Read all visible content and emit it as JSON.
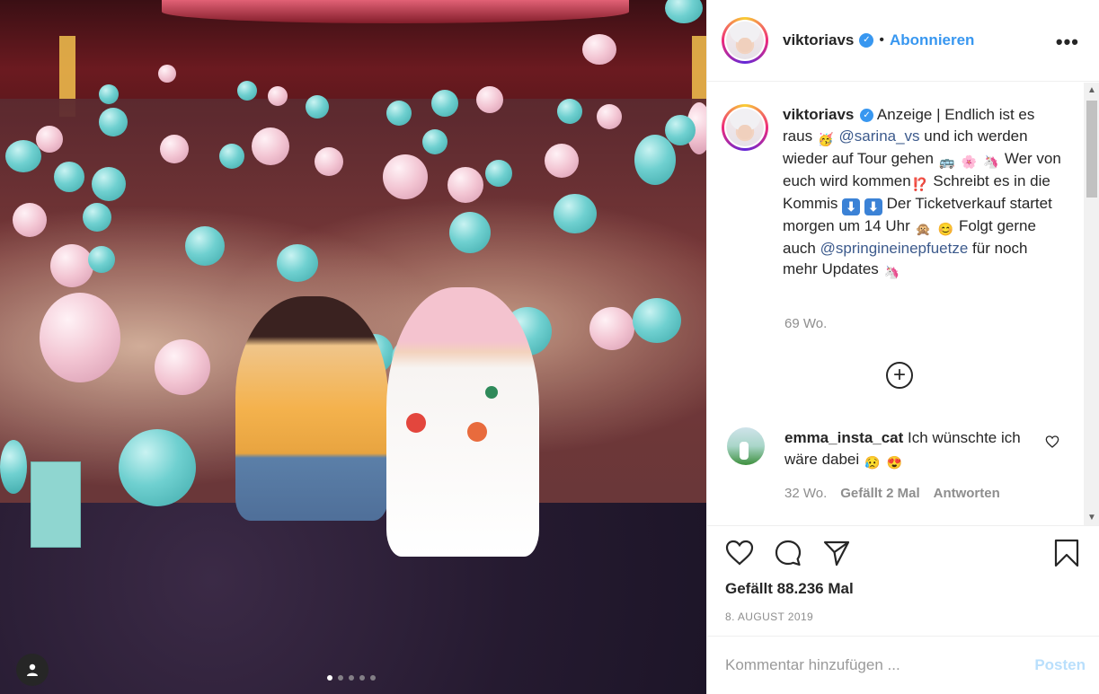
{
  "post": {
    "username": "viktoriavs",
    "verified_icon": "verified-icon",
    "separator": "•",
    "follow_label": "Abonnieren",
    "more_icon": "more-options-icon",
    "carousel": {
      "count": 5,
      "active_index": 0
    }
  },
  "caption": {
    "username": "viktoriavs",
    "part1": "Anzeige | Endlich ist es raus",
    "emoji1": "🥳",
    "mention1": "@sarina_vs",
    "part2": "und ich werden wieder auf Tour gehen",
    "emoji2": "🚌",
    "emoji3": "🌸",
    "emoji4": "🦄",
    "part3": "Wer von euch wird kommen",
    "emoji5": "⁉️",
    "part4": "Schreibt es in die Kommis",
    "emoji6": "⬇",
    "emoji7": "⬇",
    "part5": "Der Ticketverkauf startet morgen um 14 Uhr",
    "emoji8": "🙊",
    "emoji9": "😊",
    "part6": "Folgt gerne auch",
    "mention2": "@springineinepfuetze",
    "part7": "für noch mehr Updates",
    "emoji10": "🦄",
    "time": "69 Wo."
  },
  "load_more_icon": "plus-circle-icon",
  "comment": {
    "username": "emma_insta_cat",
    "text": "Ich wünschte ich wäre dabei",
    "emoji1": "😥",
    "emoji2": "😍",
    "time": "32 Wo.",
    "likes": "Gefällt 2 Mal",
    "reply": "Antworten"
  },
  "actions": {
    "like_icon": "heart-icon",
    "comment_icon": "comment-icon",
    "share_icon": "share-icon",
    "save_icon": "bookmark-icon"
  },
  "likes_text": "Gefällt 88.236 Mal",
  "date": "8. AUGUST 2019",
  "comment_box": {
    "placeholder": "Kommentar hinzufügen ...",
    "post_label": "Posten"
  },
  "colors": {
    "accent": "#3897f0",
    "post_disabled": "#b9dffc",
    "meta": "#8e8e8e"
  }
}
